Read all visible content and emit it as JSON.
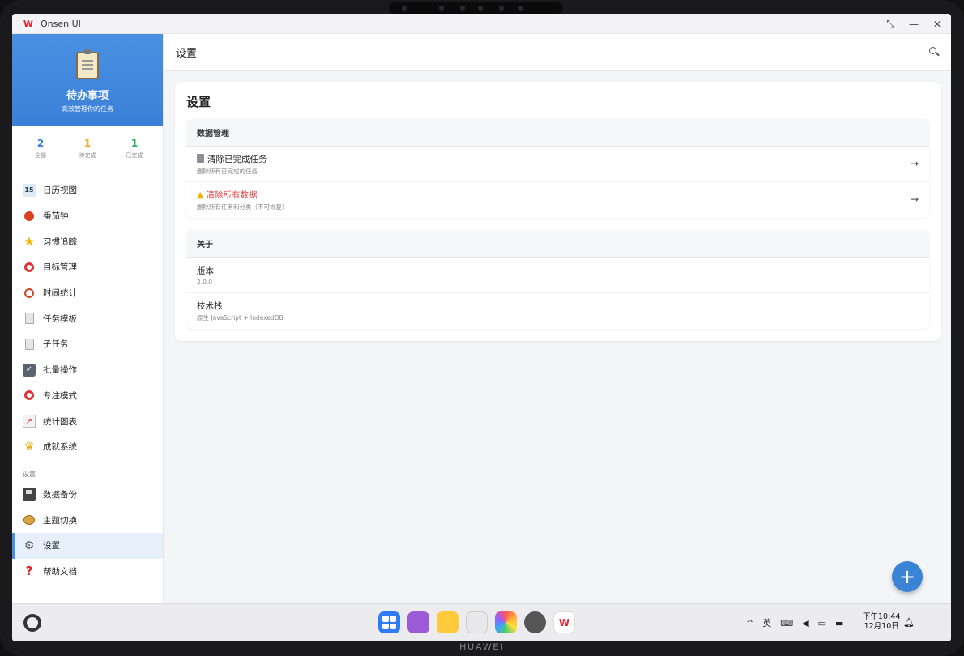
{
  "window": {
    "app_name": "Onsen UI"
  },
  "sidebar": {
    "title": "待办事项",
    "subtitle": "高效管理你的任务",
    "stats": [
      {
        "value": "2",
        "label": "全部",
        "color": "#3a80d8"
      },
      {
        "value": "1",
        "label": "待完成",
        "color": "#f5a623"
      },
      {
        "value": "1",
        "label": "已完成",
        "color": "#27ae60"
      }
    ],
    "items": [
      {
        "label": "日历视图",
        "icon": "calendar-icon"
      },
      {
        "label": "番茄钟",
        "icon": "tomato-icon"
      },
      {
        "label": "习惯追踪",
        "icon": "star-icon"
      },
      {
        "label": "目标管理",
        "icon": "target-icon"
      },
      {
        "label": "时间统计",
        "icon": "stopwatch-icon"
      },
      {
        "label": "任务模板",
        "icon": "document-icon"
      },
      {
        "label": "子任务",
        "icon": "page-icon"
      },
      {
        "label": "批量操作",
        "icon": "checkbox-icon"
      },
      {
        "label": "专注模式",
        "icon": "dart-icon"
      },
      {
        "label": "统计图表",
        "icon": "chart-icon"
      },
      {
        "label": "成就系统",
        "icon": "trophy-icon"
      }
    ],
    "settings_section_label": "设置",
    "settings_items": [
      {
        "label": "数据备份",
        "icon": "floppy-icon"
      },
      {
        "label": "主题切换",
        "icon": "palette-icon"
      },
      {
        "label": "设置",
        "icon": "gear-icon"
      },
      {
        "label": "帮助文档",
        "icon": "question-icon"
      }
    ]
  },
  "main": {
    "header_title": "设置",
    "card_title": "设置",
    "data_group": {
      "title": "数据管理",
      "rows": [
        {
          "title": "清除已完成任务",
          "desc": "删除所有已完成的任务",
          "icon": "trash-icon"
        },
        {
          "title": "清除所有数据",
          "desc": "删除所有任务和分类（不可恢复）",
          "icon": "warning-icon"
        }
      ]
    },
    "about_group": {
      "title": "关于",
      "rows": [
        {
          "title": "版本",
          "desc": "2.0.0"
        },
        {
          "title": "技术栈",
          "desc": "原生 JavaScript + IndexedDB"
        }
      ]
    },
    "fab_label": "+"
  },
  "taskbar": {
    "ime": "英",
    "time": "下午10:44",
    "date": "12月10日"
  },
  "device": {
    "brand": "HUAWEI"
  }
}
